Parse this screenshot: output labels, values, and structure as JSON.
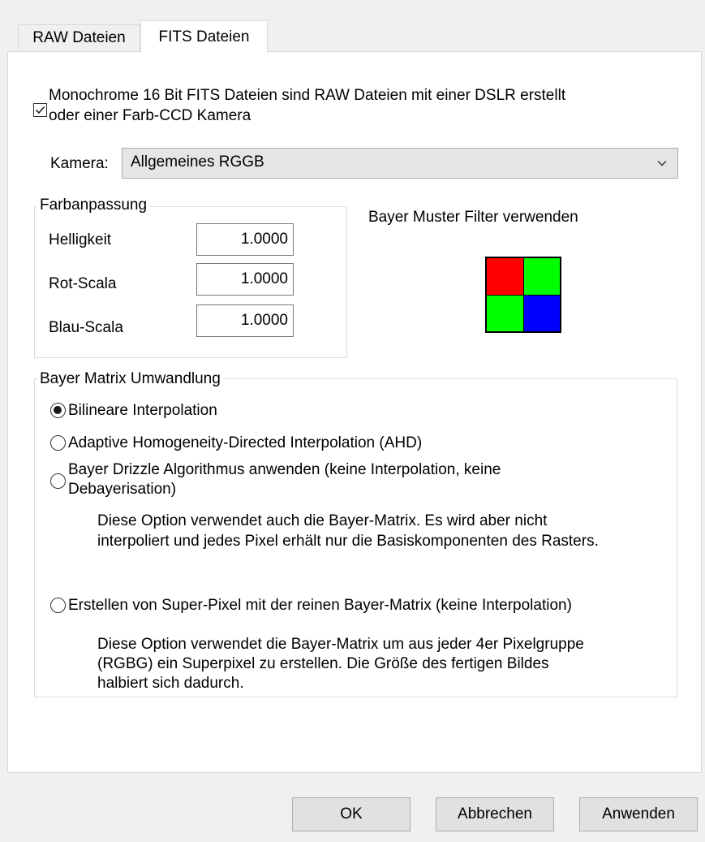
{
  "tabs": [
    {
      "label": "RAW Dateien",
      "active": false
    },
    {
      "label": "FITS Dateien",
      "active": true
    }
  ],
  "mono_checkbox": {
    "checked": true,
    "label_line1": "Monochrome 16 Bit FITS Dateien sind RAW Dateien mit einer DSLR erstellt",
    "label_line2": "oder einer Farb-CCD Kamera"
  },
  "camera": {
    "label": "Kamera:",
    "value": "Allgemeines RGGB"
  },
  "color_adjust": {
    "title": "Farbanpassung",
    "fields": [
      {
        "label": "Helligkeit",
        "value": "1.0000"
      },
      {
        "label": "Rot-Scala",
        "value": "1.0000"
      },
      {
        "label": "Blau-Scala",
        "value": "1.0000"
      }
    ]
  },
  "bayer_filter": {
    "label": "Bayer Muster Filter verwenden",
    "colors": [
      "#ff0000",
      "#00ff00",
      "#00ff00",
      "#0000ff"
    ]
  },
  "bayer_matrix": {
    "title": "Bayer Matrix Umwandlung",
    "options": [
      {
        "label": "Bilineare Interpolation",
        "checked": true
      },
      {
        "label": "Adaptive Homogeneity-Directed Interpolation (AHD)",
        "checked": false
      },
      {
        "label_line1": "Bayer Drizzle Algorithmus anwenden (keine Interpolation, keine",
        "label_line2": "Debayerisation)",
        "checked": false,
        "desc_line1": "Diese Option verwendet auch die Bayer-Matrix. Es wird aber nicht",
        "desc_line2": "interpoliert und jedes Pixel erhält nur die Basiskomponenten des Rasters."
      },
      {
        "label": "Erstellen von Super-Pixel mit der reinen Bayer-Matrix (keine Interpolation)",
        "checked": false,
        "desc_line1": "Diese Option verwendet die Bayer-Matrix um aus jeder 4er Pixelgruppe",
        "desc_line2": "(RGBG) ein Superpixel zu erstellen. Die Größe des fertigen Bildes",
        "desc_line3": "halbiert sich dadurch."
      }
    ]
  },
  "buttons": {
    "ok": "OK",
    "cancel": "Abbrechen",
    "apply": "Anwenden"
  }
}
